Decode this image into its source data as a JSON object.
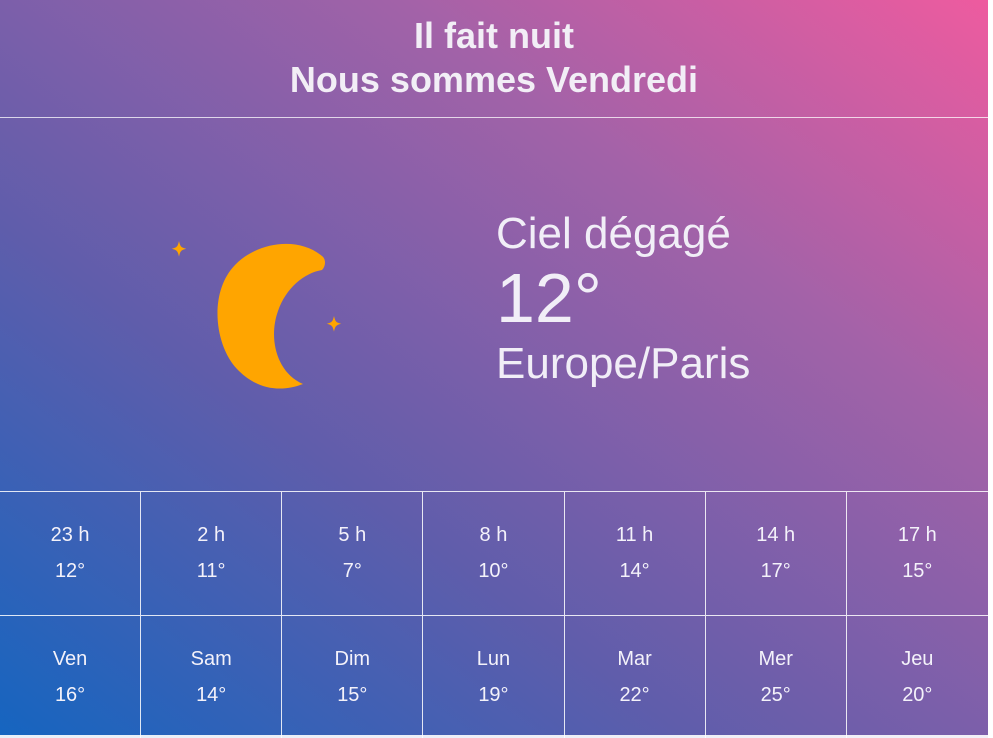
{
  "header": {
    "line1": "Il fait nuit",
    "line2": "Nous sommes Vendredi"
  },
  "current": {
    "icon": "moon-stars-icon",
    "description": "Ciel dégagé",
    "temperature": "12°",
    "timezone": "Europe/Paris"
  },
  "colors": {
    "moon": "#ffa500",
    "gradient_start": "#1565c0",
    "gradient_end": "#ee5b9f"
  },
  "hourly": [
    {
      "time": "23 h",
      "temp": "12°"
    },
    {
      "time": "2 h",
      "temp": "11°"
    },
    {
      "time": "5 h",
      "temp": "7°"
    },
    {
      "time": "8 h",
      "temp": "10°"
    },
    {
      "time": "11 h",
      "temp": "14°"
    },
    {
      "time": "14 h",
      "temp": "17°"
    },
    {
      "time": "17 h",
      "temp": "15°"
    }
  ],
  "daily": [
    {
      "day": "Ven",
      "temp": "16°"
    },
    {
      "day": "Sam",
      "temp": "14°"
    },
    {
      "day": "Dim",
      "temp": "15°"
    },
    {
      "day": "Lun",
      "temp": "19°"
    },
    {
      "day": "Mar",
      "temp": "22°"
    },
    {
      "day": "Mer",
      "temp": "25°"
    },
    {
      "day": "Jeu",
      "temp": "20°"
    }
  ]
}
